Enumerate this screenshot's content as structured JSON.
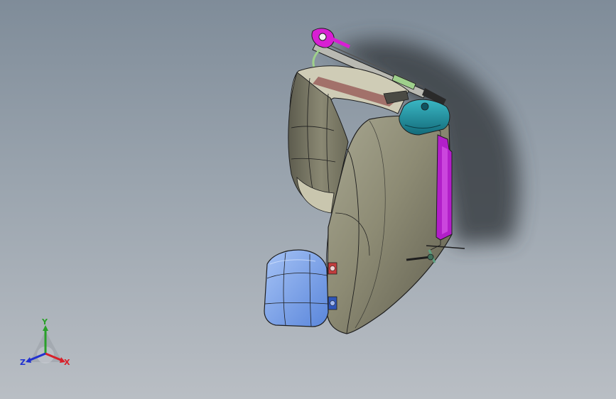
{
  "viewport": {
    "background_top": "#7f8c99",
    "background_bottom": "#b9bec4"
  },
  "model": {
    "body_color": "#8d8b74",
    "body_shade": "#6f6d5b",
    "cushion_color": "#6f9ae8",
    "bracket_color": "#b21fc9",
    "rail_color": "#c85ad3",
    "knob_color": "#1f8fa0",
    "edge_color": "#1e1e1e"
  },
  "triad": {
    "x_label": "X",
    "y_label": "Y",
    "z_label": "Z",
    "x_color": "#d8202a",
    "y_color": "#2aa02a",
    "z_color": "#2030d0"
  }
}
